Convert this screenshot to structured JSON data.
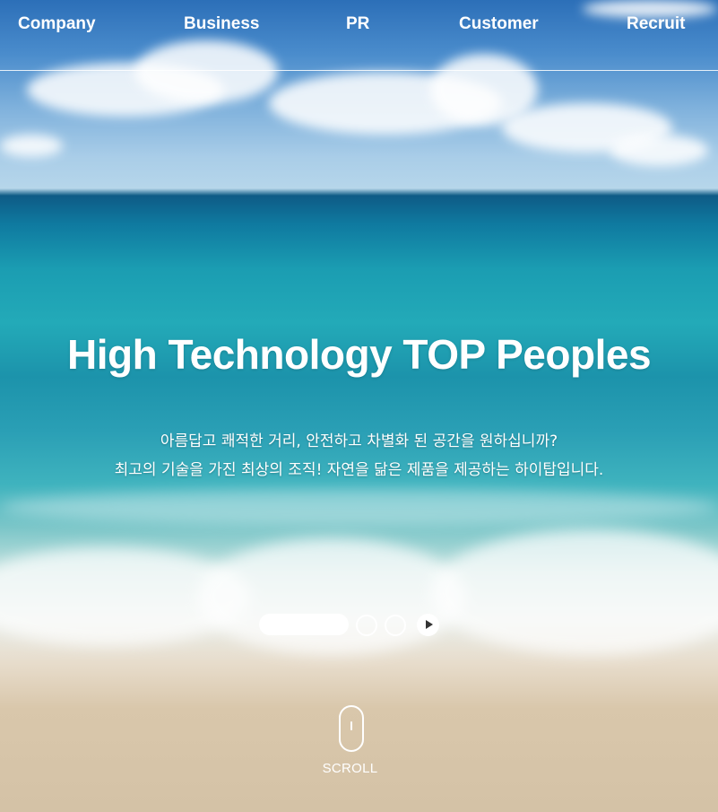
{
  "nav": {
    "items": [
      "Company",
      "Business",
      "PR",
      "Customer",
      "Recruit"
    ]
  },
  "hero": {
    "headline": "High Technology TOP Peoples",
    "sub_line1": "아름답고 쾌적한 거리, 안전하고 차별화 된 공간을 원하십니까?",
    "sub_line2": "최고의 기술을 가진 최상의 조직! 자연을 닮은 제품을 제공하는 하이탑입니다."
  },
  "slider": {
    "slide_count": 3,
    "active_index": 0,
    "control_icon": "play-icon"
  },
  "scroll": {
    "label": "SCROLL",
    "icon": "mouse-icon"
  }
}
